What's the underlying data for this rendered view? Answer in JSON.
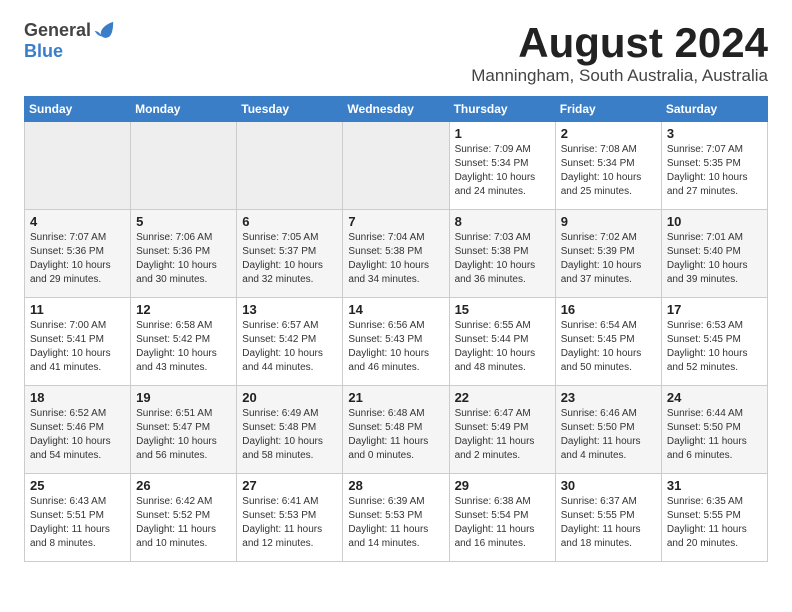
{
  "header": {
    "logo_general": "General",
    "logo_blue": "Blue",
    "title": "August 2024",
    "subtitle": "Manningham, South Australia, Australia"
  },
  "days_of_week": [
    "Sunday",
    "Monday",
    "Tuesday",
    "Wednesday",
    "Thursday",
    "Friday",
    "Saturday"
  ],
  "weeks": [
    [
      {
        "day": "",
        "info": "",
        "empty": true
      },
      {
        "day": "",
        "info": "",
        "empty": true
      },
      {
        "day": "",
        "info": "",
        "empty": true
      },
      {
        "day": "",
        "info": "",
        "empty": true
      },
      {
        "day": "1",
        "info": "Sunrise: 7:09 AM\nSunset: 5:34 PM\nDaylight: 10 hours\nand 24 minutes."
      },
      {
        "day": "2",
        "info": "Sunrise: 7:08 AM\nSunset: 5:34 PM\nDaylight: 10 hours\nand 25 minutes."
      },
      {
        "day": "3",
        "info": "Sunrise: 7:07 AM\nSunset: 5:35 PM\nDaylight: 10 hours\nand 27 minutes."
      }
    ],
    [
      {
        "day": "4",
        "info": "Sunrise: 7:07 AM\nSunset: 5:36 PM\nDaylight: 10 hours\nand 29 minutes."
      },
      {
        "day": "5",
        "info": "Sunrise: 7:06 AM\nSunset: 5:36 PM\nDaylight: 10 hours\nand 30 minutes."
      },
      {
        "day": "6",
        "info": "Sunrise: 7:05 AM\nSunset: 5:37 PM\nDaylight: 10 hours\nand 32 minutes."
      },
      {
        "day": "7",
        "info": "Sunrise: 7:04 AM\nSunset: 5:38 PM\nDaylight: 10 hours\nand 34 minutes."
      },
      {
        "day": "8",
        "info": "Sunrise: 7:03 AM\nSunset: 5:38 PM\nDaylight: 10 hours\nand 36 minutes."
      },
      {
        "day": "9",
        "info": "Sunrise: 7:02 AM\nSunset: 5:39 PM\nDaylight: 10 hours\nand 37 minutes."
      },
      {
        "day": "10",
        "info": "Sunrise: 7:01 AM\nSunset: 5:40 PM\nDaylight: 10 hours\nand 39 minutes."
      }
    ],
    [
      {
        "day": "11",
        "info": "Sunrise: 7:00 AM\nSunset: 5:41 PM\nDaylight: 10 hours\nand 41 minutes."
      },
      {
        "day": "12",
        "info": "Sunrise: 6:58 AM\nSunset: 5:42 PM\nDaylight: 10 hours\nand 43 minutes."
      },
      {
        "day": "13",
        "info": "Sunrise: 6:57 AM\nSunset: 5:42 PM\nDaylight: 10 hours\nand 44 minutes."
      },
      {
        "day": "14",
        "info": "Sunrise: 6:56 AM\nSunset: 5:43 PM\nDaylight: 10 hours\nand 46 minutes."
      },
      {
        "day": "15",
        "info": "Sunrise: 6:55 AM\nSunset: 5:44 PM\nDaylight: 10 hours\nand 48 minutes."
      },
      {
        "day": "16",
        "info": "Sunrise: 6:54 AM\nSunset: 5:45 PM\nDaylight: 10 hours\nand 50 minutes."
      },
      {
        "day": "17",
        "info": "Sunrise: 6:53 AM\nSunset: 5:45 PM\nDaylight: 10 hours\nand 52 minutes."
      }
    ],
    [
      {
        "day": "18",
        "info": "Sunrise: 6:52 AM\nSunset: 5:46 PM\nDaylight: 10 hours\nand 54 minutes."
      },
      {
        "day": "19",
        "info": "Sunrise: 6:51 AM\nSunset: 5:47 PM\nDaylight: 10 hours\nand 56 minutes."
      },
      {
        "day": "20",
        "info": "Sunrise: 6:49 AM\nSunset: 5:48 PM\nDaylight: 10 hours\nand 58 minutes."
      },
      {
        "day": "21",
        "info": "Sunrise: 6:48 AM\nSunset: 5:48 PM\nDaylight: 11 hours\nand 0 minutes."
      },
      {
        "day": "22",
        "info": "Sunrise: 6:47 AM\nSunset: 5:49 PM\nDaylight: 11 hours\nand 2 minutes."
      },
      {
        "day": "23",
        "info": "Sunrise: 6:46 AM\nSunset: 5:50 PM\nDaylight: 11 hours\nand 4 minutes."
      },
      {
        "day": "24",
        "info": "Sunrise: 6:44 AM\nSunset: 5:50 PM\nDaylight: 11 hours\nand 6 minutes."
      }
    ],
    [
      {
        "day": "25",
        "info": "Sunrise: 6:43 AM\nSunset: 5:51 PM\nDaylight: 11 hours\nand 8 minutes."
      },
      {
        "day": "26",
        "info": "Sunrise: 6:42 AM\nSunset: 5:52 PM\nDaylight: 11 hours\nand 10 minutes."
      },
      {
        "day": "27",
        "info": "Sunrise: 6:41 AM\nSunset: 5:53 PM\nDaylight: 11 hours\nand 12 minutes."
      },
      {
        "day": "28",
        "info": "Sunrise: 6:39 AM\nSunset: 5:53 PM\nDaylight: 11 hours\nand 14 minutes."
      },
      {
        "day": "29",
        "info": "Sunrise: 6:38 AM\nSunset: 5:54 PM\nDaylight: 11 hours\nand 16 minutes."
      },
      {
        "day": "30",
        "info": "Sunrise: 6:37 AM\nSunset: 5:55 PM\nDaylight: 11 hours\nand 18 minutes."
      },
      {
        "day": "31",
        "info": "Sunrise: 6:35 AM\nSunset: 5:55 PM\nDaylight: 11 hours\nand 20 minutes."
      }
    ]
  ]
}
